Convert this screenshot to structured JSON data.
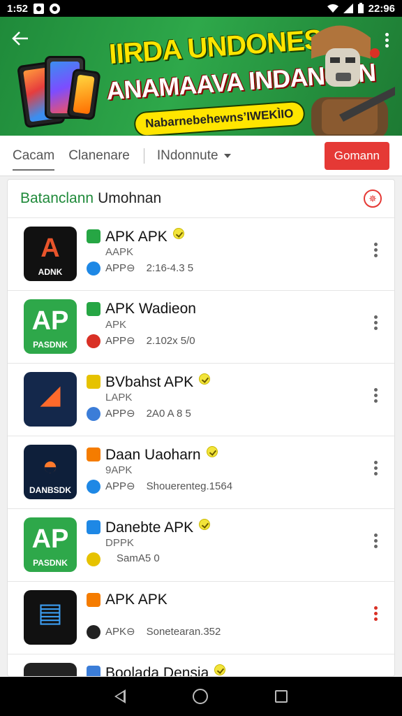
{
  "status_bar": {
    "time_left": "1:52",
    "time_right": "22:96"
  },
  "banner": {
    "title_line1": "IIRDA UNDONESAI",
    "title_line2": "ANAMAAVA INDANSAN",
    "tagline": "Nabarnebehewns’IWEKÌIO"
  },
  "tabs": {
    "items": [
      "Cacam",
      "Clanenare"
    ],
    "dropdown_label": "INdonnute",
    "action_label": "Gomann"
  },
  "list": {
    "header_green": "Batanclann",
    "header_dark": "Umohnan",
    "header_badge": "✵",
    "rows": [
      {
        "name": "APK APK",
        "verified": true,
        "type": "AAPK",
        "tag": "APP⊖",
        "info": "2:16-4.3 5",
        "icon_main": "A",
        "icon_sub": "ADNK",
        "icon_bg": "#111111",
        "icon_fg": "#e8542b",
        "mini_color": "#26a644",
        "mini2_color": "#1e88e5"
      },
      {
        "name": "APK Wadieon",
        "verified": false,
        "type": "APK",
        "tag": "APP⊖",
        "info": "2.102х 5/0",
        "icon_main": "AP",
        "icon_sub": "PASDNK",
        "icon_bg": "#2ea84a",
        "icon_fg": "#ffffff",
        "mini_color": "#26a644",
        "mini2_color": "#d93025"
      },
      {
        "name": "BVbahst APK",
        "verified": true,
        "type": "LAPK",
        "tag": "APP⊖",
        "info": "2A0 A 8 5",
        "icon_main": "◢",
        "icon_sub": "",
        "icon_bg": "#14284b",
        "icon_fg": "#ff6a2b",
        "mini_color": "#e6c200",
        "mini2_color": "#3b7dd8"
      },
      {
        "name": "Daan Uaoharn",
        "verified": true,
        "type": "9APK",
        "tag": "APP⊖",
        "info": "Shouerenteg.1564",
        "icon_main": "◓",
        "icon_sub": "DANBSDK",
        "icon_bg": "#0e1f3a",
        "icon_fg": "#ff7a2b",
        "mini_color": "#f57c00",
        "mini2_color": "#1e88e5"
      },
      {
        "name": "Danebte APK",
        "verified": true,
        "type": "DPPK",
        "tag": "",
        "info": "SamA5 0",
        "icon_main": "AP",
        "icon_sub": "PASDNK",
        "icon_bg": "#2ea84a",
        "icon_fg": "#ffffff",
        "mini_color": "#1e88e5",
        "mini2_color": "#e6c200"
      },
      {
        "name": "APK APK",
        "verified": false,
        "type": "",
        "tag": "APK⊖",
        "info": "Sonetearan.352",
        "icon_main": "▤",
        "icon_sub": "",
        "icon_bg": "#111111",
        "icon_fg": "#3b9cf0",
        "mini_color": "#f57c00",
        "mini2_color": "#222222"
      },
      {
        "name": "Boolada Densia",
        "verified": true,
        "type": "",
        "tag": "",
        "info": "",
        "icon_main": "◉",
        "icon_sub": "",
        "icon_bg": "#222222",
        "icon_fg": "#e8542b",
        "mini_color": "#3b7dd8",
        "mini2_color": "#1e88e5"
      }
    ]
  },
  "colors": {
    "accent_red": "#e53935",
    "banner_green": "#2ea84a",
    "header_green": "#1f8a3a"
  },
  "icons": [
    "back-arrow-icon",
    "more-vert-icon",
    "wifi-icon",
    "battery-icon",
    "verified-badge-icon",
    "kebab-menu-icon",
    "nav-back-icon",
    "nav-home-icon",
    "nav-recents-icon"
  ]
}
